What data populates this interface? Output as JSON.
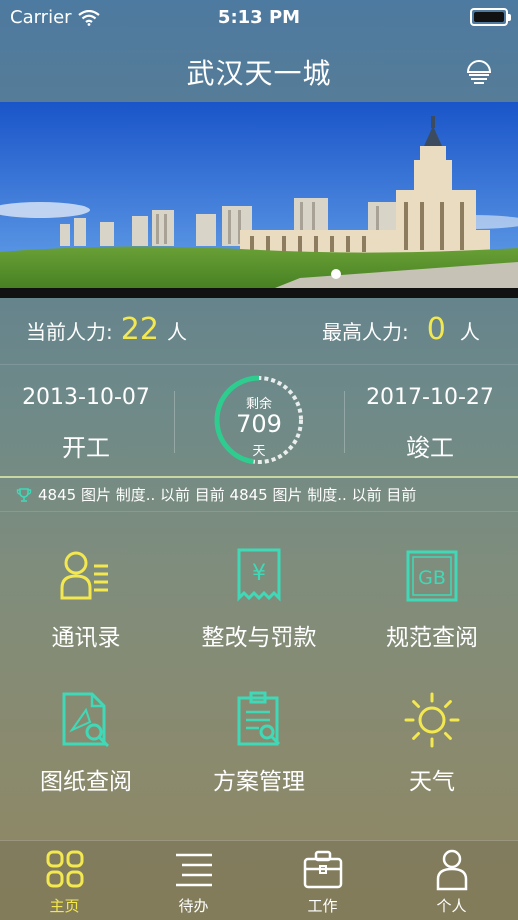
{
  "status_bar": {
    "carrier": "Carrier",
    "time": "5:13 PM"
  },
  "nav": {
    "title": "武汉天一城",
    "right_icon": "lightbulb-icon"
  },
  "workforce": {
    "current_label": "当前人力:",
    "current_value": "22",
    "current_unit": "人",
    "max_label": "最高人力:",
    "max_value": "0",
    "max_unit": "人"
  },
  "schedule": {
    "start_date": "2013-10-07",
    "start_label": "开工",
    "end_date": "2017-10-27",
    "end_label": "竣工",
    "remaining_label": "剩余",
    "remaining_days": "709",
    "remaining_unit": "天",
    "progress_fraction": 0.48
  },
  "ticker": {
    "text": "4845 图片 制度.. 以前 目前  4845 图片 制度.. 以前 目前"
  },
  "menu": [
    {
      "label": "通讯录",
      "icon": "contacts-icon"
    },
    {
      "label": "整改与罚款",
      "icon": "fine-receipt-icon"
    },
    {
      "label": "规范查阅",
      "icon": "gb-standard-icon"
    },
    {
      "label": "图纸查阅",
      "icon": "drawing-search-icon"
    },
    {
      "label": "方案管理",
      "icon": "clipboard-search-icon"
    },
    {
      "label": "天气",
      "icon": "sun-icon"
    }
  ],
  "tabs": [
    {
      "label": "主页",
      "icon": "home-grid-icon",
      "active": true
    },
    {
      "label": "待办",
      "icon": "list-icon",
      "active": false
    },
    {
      "label": "工作",
      "icon": "briefcase-icon",
      "active": false
    },
    {
      "label": "个人",
      "icon": "person-icon",
      "active": false
    }
  ],
  "colors": {
    "accent_yellow": "#f3e84f",
    "accent_teal": "#3fd9b8",
    "ring_green": "#2ecc8e"
  }
}
